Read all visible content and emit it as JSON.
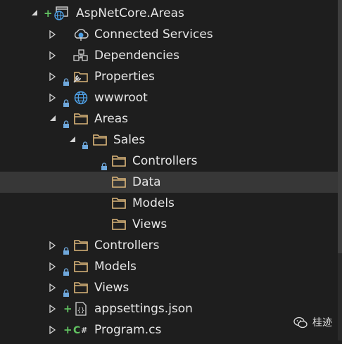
{
  "tree": {
    "project": "AspNetCore.Areas",
    "connected_services": "Connected Services",
    "dependencies": "Dependencies",
    "properties": "Properties",
    "wwwroot": "wwwroot",
    "areas": "Areas",
    "sales": "Sales",
    "sales_controllers": "Controllers",
    "sales_data": "Data",
    "sales_models": "Models",
    "sales_views": "Views",
    "controllers": "Controllers",
    "models": "Models",
    "views": "Views",
    "appsettings": "appsettings.json",
    "program": "Program.cs"
  },
  "watermark": {
    "text": "桂迹"
  },
  "colors": {
    "background": "#1e1e1e",
    "selected_row": "#373737",
    "folder": "#dcb67a",
    "lock": "#6fa8dc",
    "plus": "#62c462",
    "globe": "#4ea0e6",
    "csharp": "#62c462"
  }
}
